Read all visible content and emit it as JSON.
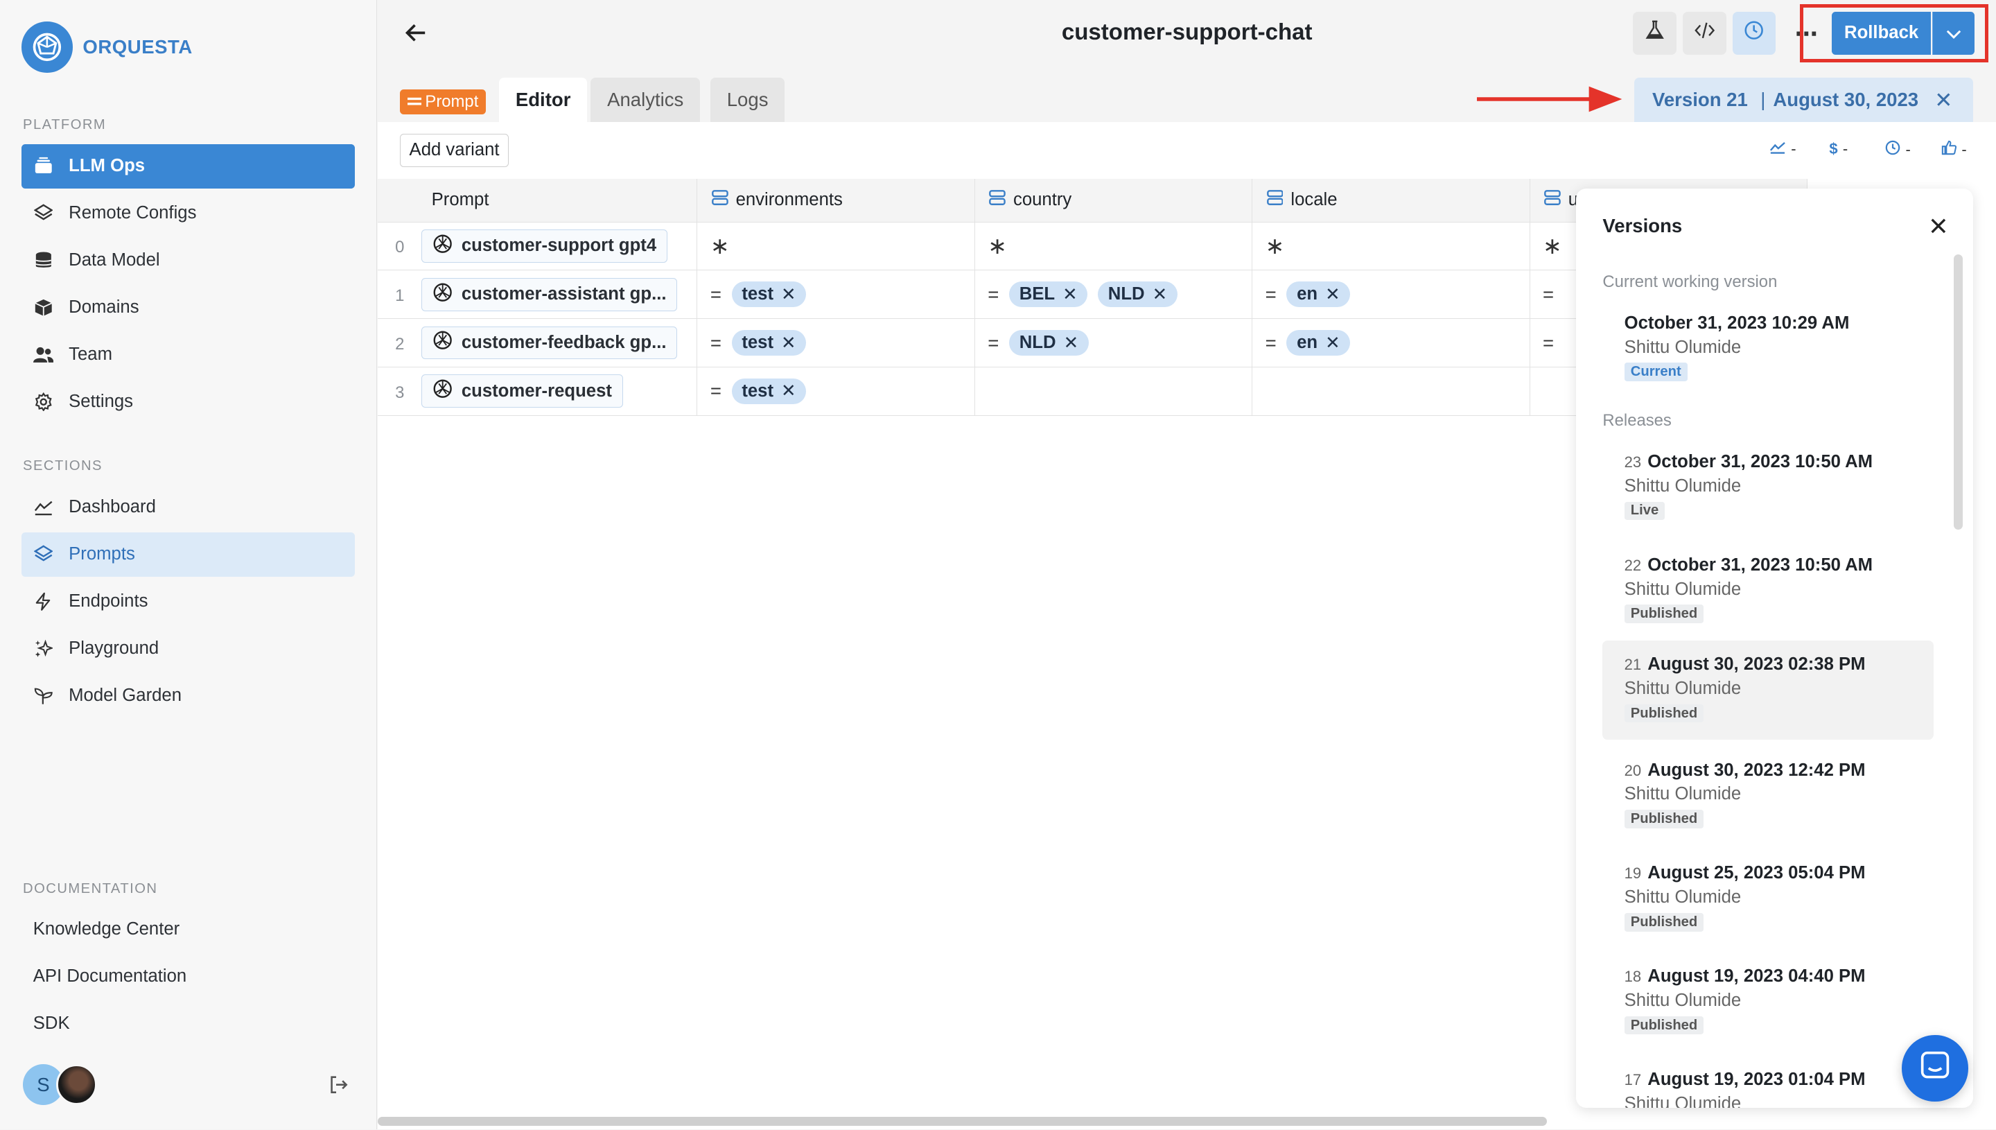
{
  "brand": {
    "name": "ORQUESTA"
  },
  "sidebar": {
    "platform_label": "PLATFORM",
    "platform_items": [
      {
        "label": "LLM Ops",
        "icon": "stack-icon"
      },
      {
        "label": "Remote Configs",
        "icon": "layers-icon"
      },
      {
        "label": "Data Model",
        "icon": "database-icon"
      },
      {
        "label": "Domains",
        "icon": "cube-icon"
      },
      {
        "label": "Team",
        "icon": "users-icon"
      },
      {
        "label": "Settings",
        "icon": "gear-icon"
      }
    ],
    "sections_label": "SECTIONS",
    "section_items": [
      {
        "label": "Dashboard",
        "icon": "chart-line-icon"
      },
      {
        "label": "Prompts",
        "icon": "layers-icon"
      },
      {
        "label": "Endpoints",
        "icon": "bolt-icon"
      },
      {
        "label": "Playground",
        "icon": "sparkles-icon"
      },
      {
        "label": "Model Garden",
        "icon": "sprout-icon"
      }
    ],
    "documentation_label": "DOCUMENTATION",
    "doc_items": [
      {
        "label": "Knowledge Center"
      },
      {
        "label": "API Documentation"
      },
      {
        "label": "SDK"
      }
    ],
    "user_initial": "S"
  },
  "header": {
    "title": "customer-support-chat",
    "more_label": "⋯",
    "rollback_label": "Rollback"
  },
  "tabs": {
    "badge": "Prompt",
    "items": [
      "Editor",
      "Analytics",
      "Logs"
    ],
    "version_label": "Version 21",
    "version_date": "August 30, 2023"
  },
  "toolbar": {
    "add_variant": "Add variant",
    "metrics": [
      "-",
      "-",
      "-",
      "-"
    ]
  },
  "table": {
    "columns": [
      "Prompt",
      "environments",
      "country",
      "locale",
      "u"
    ],
    "rows": [
      {
        "num": "0",
        "variant": "customer-support gpt4",
        "environments": "∗",
        "country": "∗",
        "locale": "∗",
        "extra": "∗"
      },
      {
        "num": "1",
        "variant": "customer-assistant gp...",
        "environments": "test",
        "country": [
          "BEL",
          "NLD"
        ],
        "locale": "en",
        "extra": "="
      },
      {
        "num": "2",
        "variant": "customer-feedback gp...",
        "environments": "test",
        "country": [
          "NLD"
        ],
        "locale": "en",
        "extra": "="
      },
      {
        "num": "3",
        "variant": "customer-request",
        "environments": "test",
        "country": [],
        "locale": "",
        "extra": ""
      }
    ],
    "eq": "="
  },
  "versions_panel": {
    "title": "Versions",
    "current_label": "Current working version",
    "current": {
      "date": "October 31, 2023 10:29 AM",
      "author": "Shittu Olumide",
      "tag": "Current"
    },
    "releases_label": "Releases",
    "releases": [
      {
        "num": "23",
        "date": "October 31, 2023 10:50 AM",
        "author": "Shittu Olumide",
        "tag": "Live"
      },
      {
        "num": "22",
        "date": "October 31, 2023 10:50 AM",
        "author": "Shittu Olumide",
        "tag": "Published"
      },
      {
        "num": "21",
        "date": "August 30, 2023 02:38 PM",
        "author": "Shittu Olumide",
        "tag": "Published"
      },
      {
        "num": "20",
        "date": "August 30, 2023 12:42 PM",
        "author": "Shittu Olumide",
        "tag": "Published"
      },
      {
        "num": "19",
        "date": "August 25, 2023 05:04 PM",
        "author": "Shittu Olumide",
        "tag": "Published"
      },
      {
        "num": "18",
        "date": "August 19, 2023 04:40 PM",
        "author": "Shittu Olumide",
        "tag": "Published"
      },
      {
        "num": "17",
        "date": "August 19, 2023 01:04 PM",
        "author": "Shittu Olumide",
        "tag": ""
      }
    ]
  },
  "colors": {
    "accent": "#3a87d4",
    "highlight_box": "#e4332a",
    "badge": "#f07c2b"
  }
}
